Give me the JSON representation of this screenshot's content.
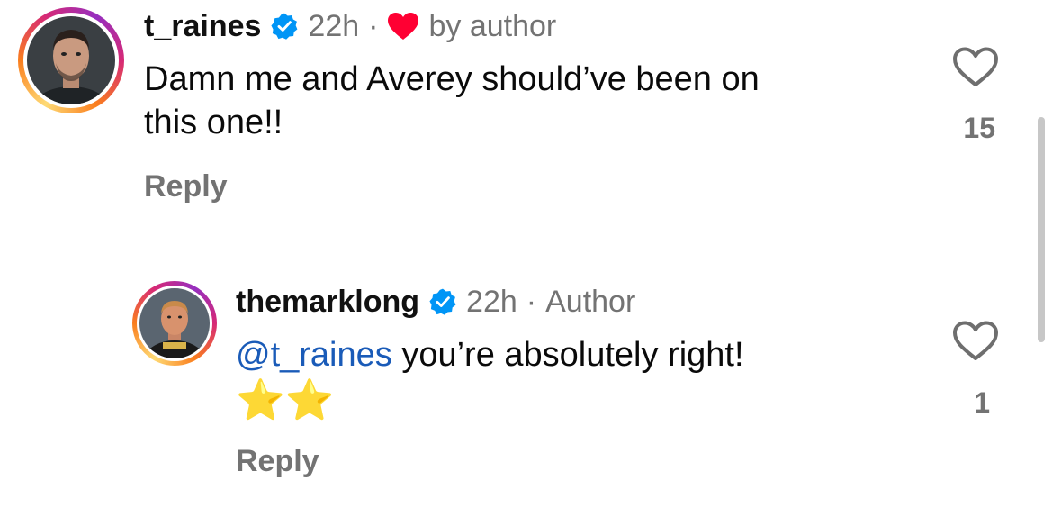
{
  "comments": [
    {
      "username": "t_raines",
      "time": "22h",
      "separator": "·",
      "author_like": "by author",
      "text_line1": "Damn me and Averey should’ve been on",
      "text_line2": "this one!!",
      "reply_label": "Reply",
      "like_count": "15"
    },
    {
      "username": "themarklong",
      "time": "22h",
      "separator": "·",
      "badge": "Author",
      "mention": "@t_raines",
      "text": " you’re absolutely right!",
      "emojis": "⭐⭐",
      "reply_label": "Reply",
      "like_count": "1"
    }
  ],
  "colors": {
    "verified": "#0095f6",
    "author_heart": "#ff0033",
    "mention": "#1a5bb8",
    "muted": "#737373"
  },
  "icons": [
    "verified-badge-icon",
    "heart-icon",
    "like-heart-outline-icon"
  ]
}
